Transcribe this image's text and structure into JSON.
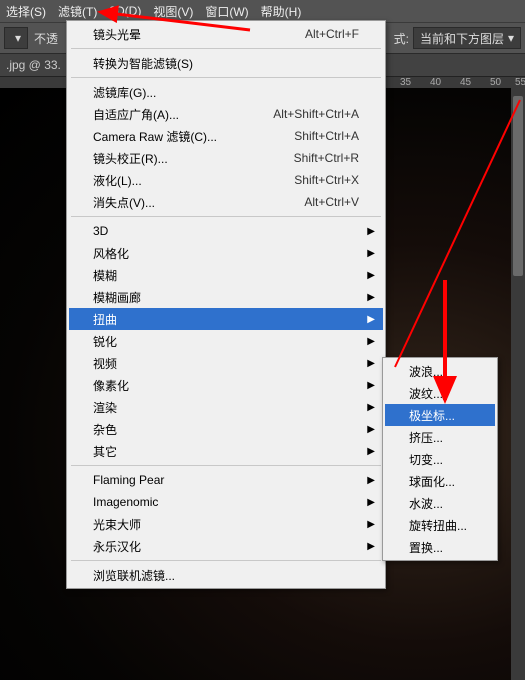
{
  "menubar": {
    "items": [
      "选择(S)",
      "滤镜(T)",
      "3D(D)",
      "视图(V)",
      "窗口(W)",
      "帮助(H)"
    ]
  },
  "toolbar": {
    "left_text": "不透",
    "mode_label": "式:",
    "mode_value": "当前和下方图层"
  },
  "tab": {
    "label": ".jpg @ 33."
  },
  "ruler": {
    "marks": [
      "35",
      "40",
      "45",
      "50",
      "55"
    ]
  },
  "mainmenu": {
    "groups": [
      [
        {
          "label": "镜头光晕",
          "shortcut": "Alt+Ctrl+F"
        }
      ],
      [
        {
          "label": "转换为智能滤镜(S)"
        }
      ],
      [
        {
          "label": "滤镜库(G)..."
        },
        {
          "label": "自适应广角(A)...",
          "shortcut": "Alt+Shift+Ctrl+A"
        },
        {
          "label": "Camera Raw 滤镜(C)...",
          "shortcut": "Shift+Ctrl+A"
        },
        {
          "label": "镜头校正(R)...",
          "shortcut": "Shift+Ctrl+R"
        },
        {
          "label": "液化(L)...",
          "shortcut": "Shift+Ctrl+X"
        },
        {
          "label": "消失点(V)...",
          "shortcut": "Alt+Ctrl+V"
        }
      ],
      [
        {
          "label": "3D",
          "submenu": true
        },
        {
          "label": "风格化",
          "submenu": true
        },
        {
          "label": "模糊",
          "submenu": true
        },
        {
          "label": "模糊画廊",
          "submenu": true
        },
        {
          "label": "扭曲",
          "submenu": true,
          "hover": true
        },
        {
          "label": "锐化",
          "submenu": true
        },
        {
          "label": "视频",
          "submenu": true
        },
        {
          "label": "像素化",
          "submenu": true
        },
        {
          "label": "渲染",
          "submenu": true
        },
        {
          "label": "杂色",
          "submenu": true
        },
        {
          "label": "其它",
          "submenu": true
        }
      ],
      [
        {
          "label": "Flaming Pear",
          "submenu": true
        },
        {
          "label": "Imagenomic",
          "submenu": true
        },
        {
          "label": "光束大师",
          "submenu": true
        },
        {
          "label": "永乐汉化",
          "submenu": true
        }
      ],
      [
        {
          "label": "浏览联机滤镜..."
        }
      ]
    ]
  },
  "submenu": {
    "items": [
      {
        "label": "波浪..."
      },
      {
        "label": "波纹..."
      },
      {
        "label": "极坐标...",
        "hover": true
      },
      {
        "label": "挤压..."
      },
      {
        "label": "切变..."
      },
      {
        "label": "球面化..."
      },
      {
        "label": "水波..."
      },
      {
        "label": "旋转扭曲..."
      },
      {
        "label": "置换..."
      }
    ]
  }
}
